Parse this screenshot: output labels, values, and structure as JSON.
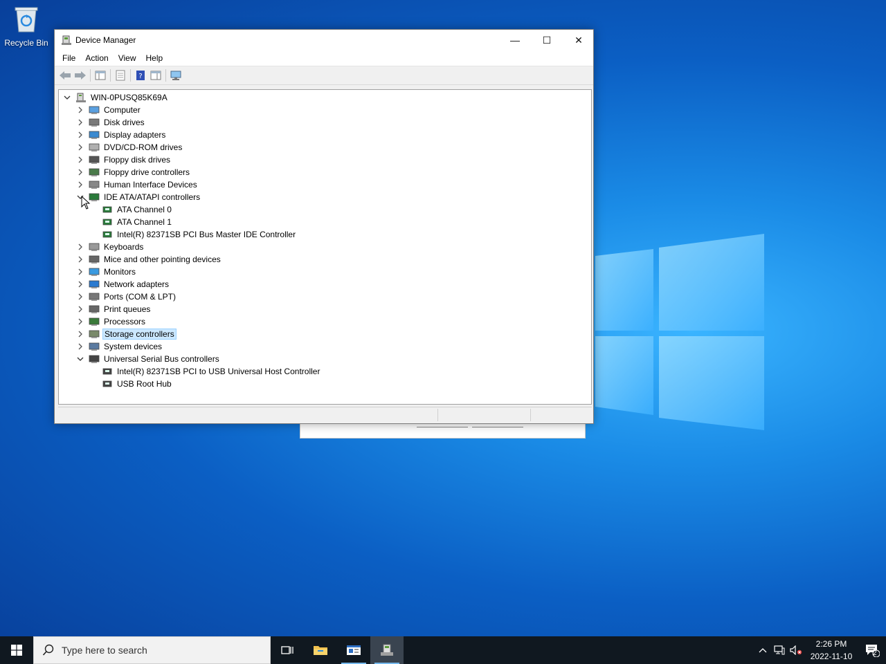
{
  "desktop": {
    "recycle_bin_label": "Recycle Bin"
  },
  "window": {
    "title": "Device Manager",
    "menu": [
      "File",
      "Action",
      "View",
      "Help"
    ],
    "minimize": "—",
    "maximize": "☐",
    "close": "✕"
  },
  "tree": {
    "root": "WIN-0PUSQ85K69A",
    "items": [
      {
        "label": "Computer",
        "icon": "computer-icon",
        "expanded": false
      },
      {
        "label": "Disk drives",
        "icon": "disk-drive-icon",
        "expanded": false
      },
      {
        "label": "Display adapters",
        "icon": "display-adapter-icon",
        "expanded": false
      },
      {
        "label": "DVD/CD-ROM drives",
        "icon": "dvd-drive-icon",
        "expanded": false
      },
      {
        "label": "Floppy disk drives",
        "icon": "floppy-drive-icon",
        "expanded": false
      },
      {
        "label": "Floppy drive controllers",
        "icon": "floppy-controller-icon",
        "expanded": false
      },
      {
        "label": "Human Interface Devices",
        "icon": "hid-icon",
        "expanded": false
      },
      {
        "label": "IDE ATA/ATAPI controllers",
        "icon": "ide-controller-icon",
        "expanded": true,
        "children": [
          "ATA Channel 0",
          "ATA Channel 1",
          "Intel(R) 82371SB PCI Bus Master IDE Controller"
        ]
      },
      {
        "label": "Keyboards",
        "icon": "keyboard-icon",
        "expanded": false
      },
      {
        "label": "Mice and other pointing devices",
        "icon": "mouse-icon",
        "expanded": false
      },
      {
        "label": "Monitors",
        "icon": "monitor-icon",
        "expanded": false
      },
      {
        "label": "Network adapters",
        "icon": "network-adapter-icon",
        "expanded": false
      },
      {
        "label": "Ports (COM & LPT)",
        "icon": "port-icon",
        "expanded": false
      },
      {
        "label": "Print queues",
        "icon": "printer-icon",
        "expanded": false
      },
      {
        "label": "Processors",
        "icon": "processor-icon",
        "expanded": false
      },
      {
        "label": "Storage controllers",
        "icon": "storage-controller-icon",
        "expanded": false,
        "selected": true
      },
      {
        "label": "System devices",
        "icon": "system-device-icon",
        "expanded": false
      },
      {
        "label": "Universal Serial Bus controllers",
        "icon": "usb-icon",
        "expanded": true,
        "children": [
          "Intel(R) 82371SB PCI to USB Universal Host Controller",
          "USB Root Hub"
        ]
      }
    ]
  },
  "taskbar": {
    "search_placeholder": "Type here to search",
    "time": "2:26 PM",
    "date": "2022-11-10",
    "notification_count": "2"
  },
  "colors": {
    "selection_bg": "#cce8ff",
    "selection_border": "#99d1ff",
    "taskbar": "#101820",
    "accent": "#76b9ed"
  }
}
